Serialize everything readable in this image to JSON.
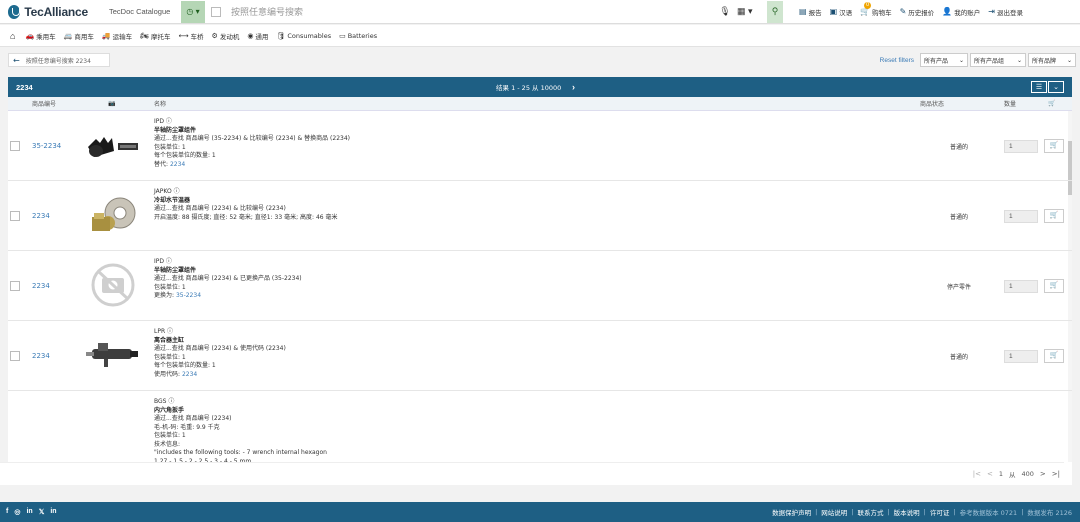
{
  "topbar": {
    "logo_name": "TecAlliance",
    "catalogue": "TecDoc Catalogue",
    "history_icon": "history-clock-icon",
    "search_placeholder": "按照任意编号搜索",
    "links": [
      {
        "icon": "report-icon",
        "glyph": "▤",
        "label": "报告"
      },
      {
        "icon": "language-icon",
        "glyph": "▣",
        "label": "汉语"
      },
      {
        "icon": "cart-icon",
        "glyph": "🛒",
        "label": "购物车",
        "badge": "0"
      },
      {
        "icon": "history-price-icon",
        "glyph": "✎",
        "label": "历史报价"
      },
      {
        "icon": "account-icon",
        "glyph": "👤",
        "label": "我的账户"
      },
      {
        "icon": "logout-icon",
        "glyph": "⇥",
        "label": "退出登录"
      }
    ]
  },
  "catbar": {
    "items": [
      {
        "icon": "car-icon",
        "glyph": "🚗",
        "label": "乘用车"
      },
      {
        "icon": "commercial-vehicle-icon",
        "glyph": "🚐",
        "label": "商用车"
      },
      {
        "icon": "truck-icon",
        "glyph": "🚚",
        "label": "运输车"
      },
      {
        "icon": "motorcycle-icon",
        "glyph": "🏍",
        "label": "摩托车"
      },
      {
        "icon": "axle-icon",
        "glyph": "⟷",
        "label": "车桥"
      },
      {
        "icon": "engine-icon",
        "glyph": "⚙",
        "label": "发动机"
      },
      {
        "icon": "universal-icon",
        "glyph": "◉",
        "label": "通用"
      },
      {
        "icon": "consumables-icon",
        "glyph": "🛢",
        "label": "Consumables"
      },
      {
        "icon": "batteries-icon",
        "glyph": "▭",
        "label": "Batteries"
      }
    ]
  },
  "filterbar": {
    "crumb": "按照任意编号搜索 2234",
    "reset": "Reset filters",
    "dropdowns": [
      "所有产品",
      "所有产品组",
      "所有品牌"
    ]
  },
  "results": {
    "query": "2234",
    "count": "结果 1 - 25 从 10000",
    "columns": {
      "part_no": "商品编号",
      "name": "名称",
      "status": "商品状态",
      "qty": "数量"
    },
    "rows": [
      {
        "part_no": "35-2234",
        "brand": "IPD",
        "title": "半轴防尘罩组件",
        "lines": [
          {
            "text": "通过...查找 商品编号 (35-2234) & 比较编号 (2234) & 替换商品 (2234)"
          },
          {
            "text": "包装单位: 1"
          },
          {
            "text": "每个包装单位的数量: 1"
          },
          {
            "text": "替代: ",
            "link": "2234"
          }
        ],
        "status": "普通的",
        "qty": "1",
        "thumb": "boot"
      },
      {
        "part_no": "2234",
        "brand": "JAPKO",
        "title": "冷却水节温器",
        "lines": [
          {
            "text": "通过...查找 商品编号 (2234) & 比较编号 (2234)"
          },
          {
            "text": "开启温度: 88 摄氏度; 直径: 52 毫米; 直径1: 33 毫米; 高度: 46 毫米"
          }
        ],
        "status": "普通的",
        "qty": "1",
        "thumb": "thermostat"
      },
      {
        "part_no": "2234",
        "brand": "IPD",
        "title": "半轴防尘罩组件",
        "lines": [
          {
            "text": "通过...查找 商品编号 (2234) & 已更换产品 (35-2234)"
          },
          {
            "text": "包装单位: 1"
          },
          {
            "text": "更换为: ",
            "link": "35-2234"
          }
        ],
        "status": "停产零件",
        "qty": "1",
        "thumb": "noimage"
      },
      {
        "part_no": "2234",
        "brand": "LPR",
        "title": "离合器主缸",
        "lines": [
          {
            "text": "通过...查找 商品编号 (2234) & 使用代码 (2234)"
          },
          {
            "text": "包装单位: 1"
          },
          {
            "text": "每个包装单位的数量: 1"
          },
          {
            "text": "使用代码: ",
            "link": "2234"
          }
        ],
        "status": "普通的",
        "qty": "1",
        "thumb": "cylinder"
      },
      {
        "part_no": "",
        "brand": "BGS",
        "title": "内六角扳手",
        "lines": [
          {
            "text": "通过...查找 商品编号 (2234)"
          },
          {
            "text": "毛-机-码: 毛重: 9.9 千克"
          },
          {
            "text": "包装单位: 1"
          },
          {
            "text": "技术信息:"
          },
          {
            "text": "\"includes the following tools: - 7 wrench internal hexagon"
          },
          {
            "text": "1.27 - 1.5 - 2 - 2.5 - 3 - 4 - 5 mm"
          }
        ],
        "status": "",
        "qty": "",
        "thumb": "none"
      }
    ]
  },
  "pager": {
    "page": "1",
    "of_label": "从",
    "total": "400"
  },
  "footer": {
    "social": [
      "f",
      "◎",
      "in",
      "𝕏",
      "in"
    ],
    "links": [
      "数据保护声明",
      "网站说明",
      "联系方式",
      "版本说明",
      "许可证"
    ],
    "muted": [
      "参考数据版本 0721",
      "数据发布 2126"
    ]
  }
}
